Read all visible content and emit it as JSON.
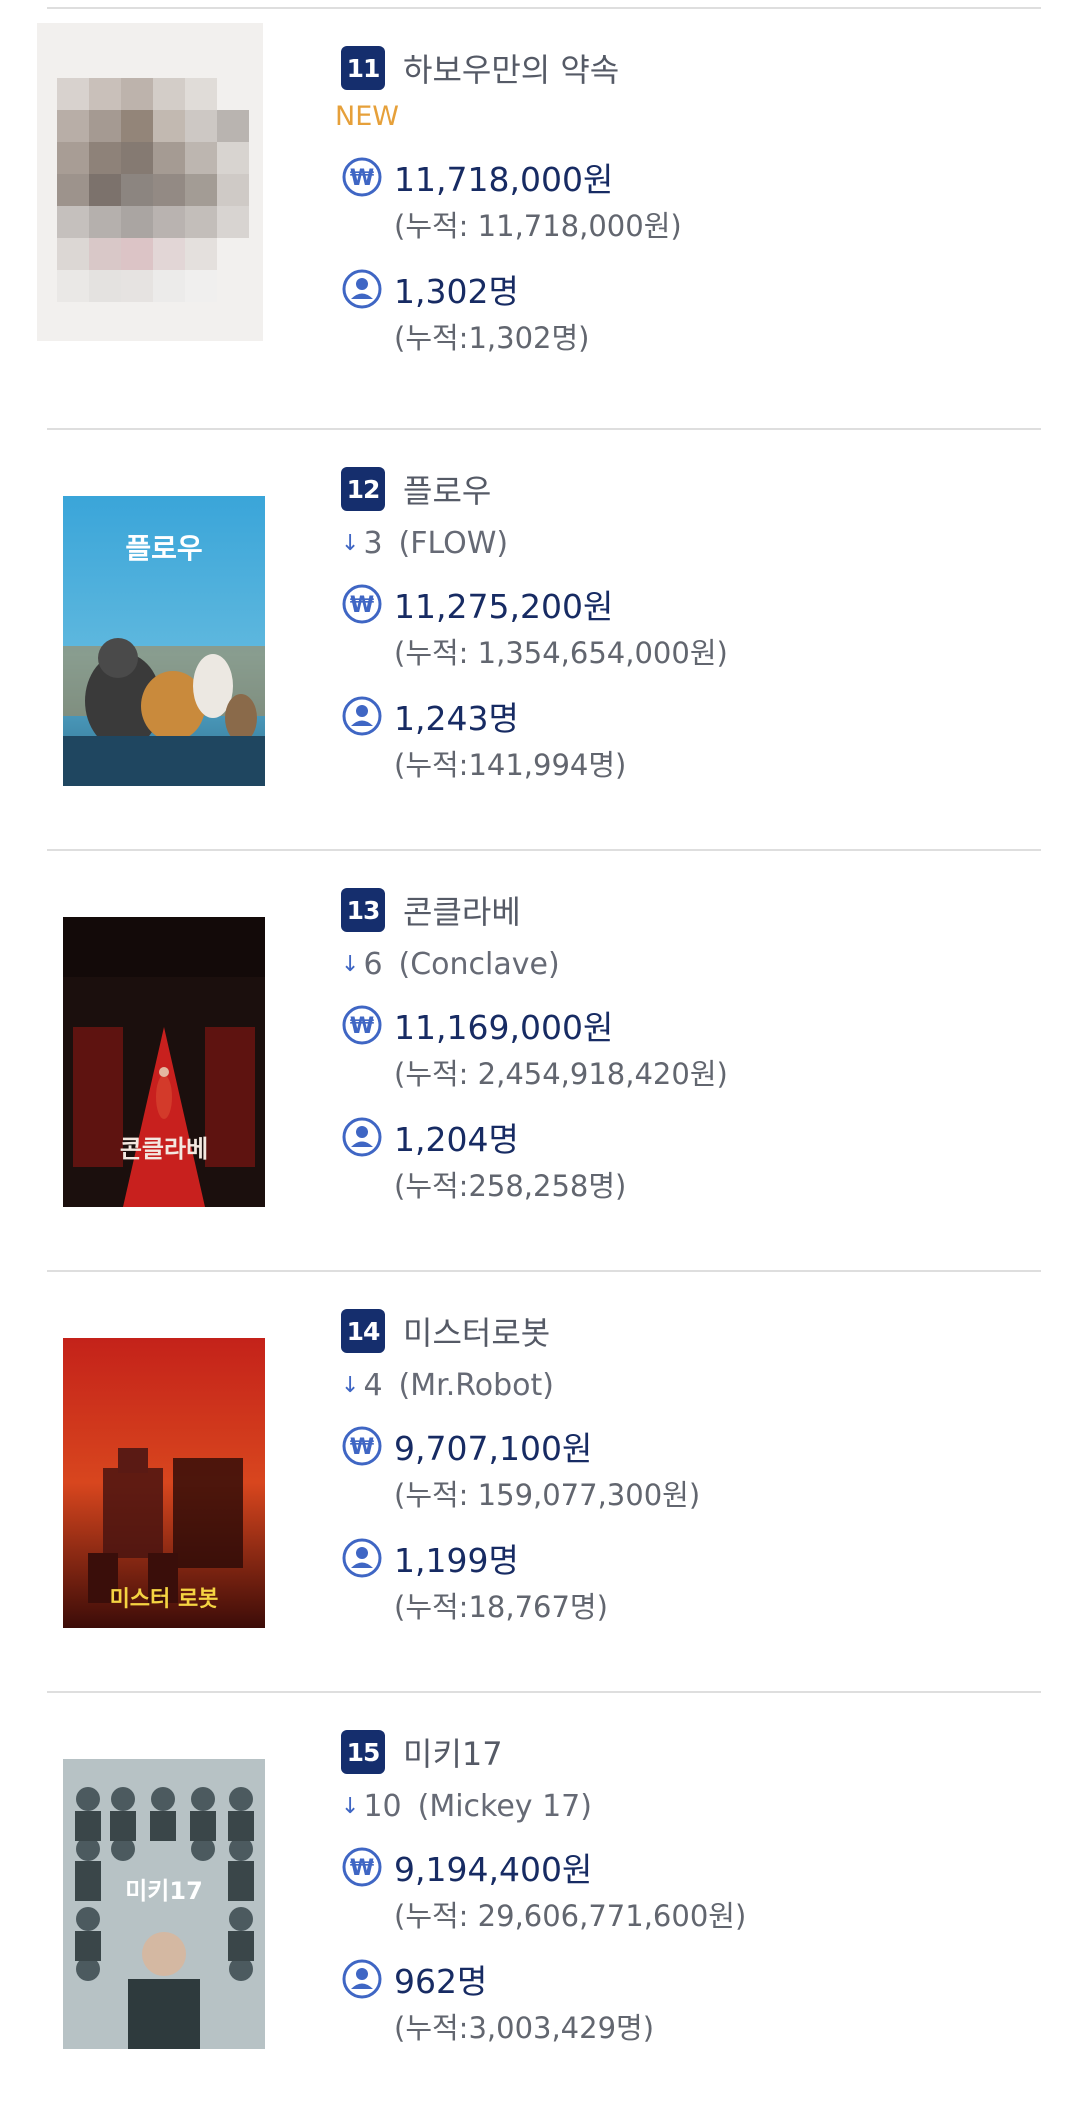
{
  "currency_symbol": "₩",
  "entries": [
    {
      "rank": "11",
      "title": "하보우만의 약속",
      "badge": "NEW",
      "change": "",
      "original_title": "",
      "revenue": "11,718,000원",
      "revenue_cum": "(누적: 11,718,000원)",
      "audience": "1,302명",
      "audience_cum": "(누적:1,302명)",
      "poster_text": ""
    },
    {
      "rank": "12",
      "title": "플로우",
      "badge": "",
      "change": "3",
      "original_title": "(FLOW)",
      "revenue": "11,275,200원",
      "revenue_cum": "(누적: 1,354,654,000원)",
      "audience": "1,243명",
      "audience_cum": "(누적:141,994명)",
      "poster_text": "플로우"
    },
    {
      "rank": "13",
      "title": "콘클라베",
      "badge": "",
      "change": "6",
      "original_title": "(Conclave)",
      "revenue": "11,169,000원",
      "revenue_cum": "(누적: 2,454,918,420원)",
      "audience": "1,204명",
      "audience_cum": "(누적:258,258명)",
      "poster_text": "콘클라베"
    },
    {
      "rank": "14",
      "title": "미스터로봇",
      "badge": "",
      "change": "4",
      "original_title": "(Mr.Robot)",
      "revenue": "9,707,100원",
      "revenue_cum": "(누적: 159,077,300원)",
      "audience": "1,199명",
      "audience_cum": "(누적:18,767명)",
      "poster_text": "미스터 로봇"
    },
    {
      "rank": "15",
      "title": "미키17",
      "badge": "",
      "change": "10",
      "original_title": "(Mickey 17)",
      "revenue": "9,194,400원",
      "revenue_cum": "(누적: 29,606,771,600원)",
      "audience": "962명",
      "audience_cum": "(누적:3,003,429명)",
      "poster_text": "미키17"
    }
  ],
  "colors": {
    "rank_badge": "#152e6d",
    "value_text": "#172b63",
    "icon_blue": "#3f66c4",
    "new_badge": "#e6a03a"
  }
}
